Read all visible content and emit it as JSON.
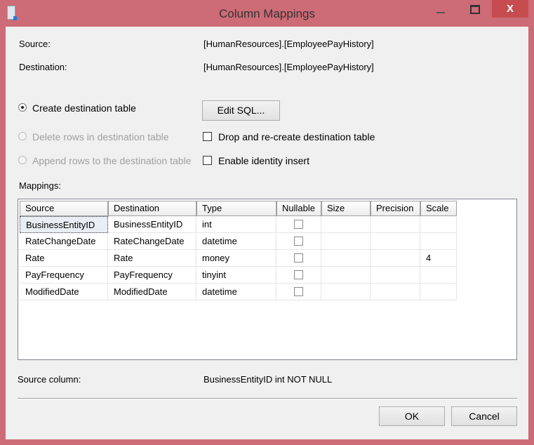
{
  "window": {
    "title": "Column Mappings",
    "close_glyph": "X"
  },
  "source_label": "Source:",
  "source_value": "[HumanResources].[EmployeePayHistory]",
  "destination_label": "Destination:",
  "destination_value": "[HumanResources].[EmployeePayHistory]",
  "options": {
    "create": "Create destination table",
    "delete": "Delete rows in destination table",
    "append": "Append rows to the destination table",
    "selected": "create",
    "edit_sql": "Edit SQL...",
    "drop_recreate": "Drop and re-create destination table",
    "drop_recreate_checked": false,
    "identity_insert": "Enable identity insert",
    "identity_insert_checked": false
  },
  "mappings_label": "Mappings:",
  "columns": [
    "Source",
    "Destination",
    "Type",
    "Nullable",
    "Size",
    "Precision",
    "Scale"
  ],
  "rows": [
    {
      "source": "BusinessEntityID",
      "destination": "BusinessEntityID",
      "type": "int",
      "nullable": false,
      "size": "",
      "precision": "",
      "scale": ""
    },
    {
      "source": "RateChangeDate",
      "destination": "RateChangeDate",
      "type": "datetime",
      "nullable": false,
      "size": "",
      "precision": "",
      "scale": ""
    },
    {
      "source": "Rate",
      "destination": "Rate",
      "type": "money",
      "nullable": false,
      "size": "",
      "precision": "",
      "scale": "4"
    },
    {
      "source": "PayFrequency",
      "destination": "PayFrequency",
      "type": "tinyint",
      "nullable": false,
      "size": "",
      "precision": "",
      "scale": ""
    },
    {
      "source": "ModifiedDate",
      "destination": "ModifiedDate",
      "type": "datetime",
      "nullable": false,
      "size": "",
      "precision": "",
      "scale": ""
    }
  ],
  "source_column_label": "Source column:",
  "source_column_value": "BusinessEntityID int NOT NULL",
  "ok": "OK",
  "cancel": "Cancel"
}
